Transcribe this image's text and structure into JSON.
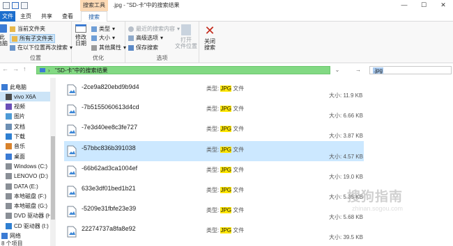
{
  "window": {
    "search_tools_label": "搜索工具",
    "title": ".jpg - \"SD-卡\"中的搜索结果",
    "minimize": "—",
    "maximize": "☐",
    "close": "✕"
  },
  "tabs": [
    "文件",
    "主页",
    "共享",
    "查看",
    "搜索"
  ],
  "ribbon": {
    "location": {
      "label": "位置",
      "this_pc": "此\n电脑",
      "current_folder": "当前文件夹",
      "all_subfolders": "所有子文件夹",
      "search_again": "在以下位置再次搜索"
    },
    "refine": {
      "label": "优化",
      "modified_date": "修改\n日期",
      "type": "类型",
      "size": "大小",
      "other_props": "其他属性"
    },
    "options": {
      "label": "选项",
      "recent": "最近的搜索内容",
      "advanced": "高级选项",
      "save_search": "保存搜索",
      "open_location": "打开\n文件位置"
    },
    "close": {
      "label": "关闭\n搜索"
    }
  },
  "address": {
    "path": "\"SD-卡\"中的搜索结果",
    "search_value": ".jpg"
  },
  "nav": [
    {
      "label": "此电脑",
      "icon": "computer-icon",
      "indent": 0
    },
    {
      "label": "vivo X6A",
      "icon": "phone-icon",
      "indent": 1,
      "selected": true
    },
    {
      "label": "视频",
      "icon": "video-folder-icon",
      "indent": 1
    },
    {
      "label": "图片",
      "icon": "pictures-folder-icon",
      "indent": 1
    },
    {
      "label": "文档",
      "icon": "documents-folder-icon",
      "indent": 1
    },
    {
      "label": "下载",
      "icon": "downloads-folder-icon",
      "indent": 1
    },
    {
      "label": "音乐",
      "icon": "music-folder-icon",
      "indent": 1
    },
    {
      "label": "桌面",
      "icon": "desktop-folder-icon",
      "indent": 1
    },
    {
      "label": "Windows (C:)",
      "icon": "drive-icon",
      "indent": 1
    },
    {
      "label": "LENOVO (D:)",
      "icon": "drive-icon",
      "indent": 1
    },
    {
      "label": "DATA (E:)",
      "icon": "drive-icon",
      "indent": 1
    },
    {
      "label": "本地磁盘 (F:)",
      "icon": "drive-icon",
      "indent": 1
    },
    {
      "label": "本地磁盘 (G:)",
      "icon": "drive-icon",
      "indent": 1
    },
    {
      "label": "DVD 驱动器 (H:)",
      "icon": "dvd-icon",
      "indent": 1
    },
    {
      "label": "CD 驱动器 (I:) vi",
      "icon": "cd-icon",
      "indent": 1
    },
    {
      "label": "网络",
      "icon": "network-icon",
      "indent": 0
    }
  ],
  "status": "8 个项目",
  "files": [
    {
      "name": "-2ce9a820ebd9b9d4",
      "type_prefix": "类型: ",
      "type_hl": "JPG",
      "type_suffix": " 文件",
      "size": "大小: 11.9 KB"
    },
    {
      "name": "-7b5155060613d4cd",
      "type_prefix": "类型: ",
      "type_hl": "JPG",
      "type_suffix": " 文件",
      "size": "大小: 6.66 KB"
    },
    {
      "name": "-7e3d40ee8c3fe727",
      "type_prefix": "类型: ",
      "type_hl": "JPG",
      "type_suffix": " 文件",
      "size": "大小: 3.87 KB"
    },
    {
      "name": "-57bbc836b391038",
      "type_prefix": "类型: ",
      "type_hl": "JPG",
      "type_suffix": " 文件",
      "size": "大小: 4.57 KB",
      "selected": true
    },
    {
      "name": "-66b62ad3ca1004ef",
      "type_prefix": "类型: ",
      "type_hl": "JPG",
      "type_suffix": " 文件",
      "size": "大小: 19.0 KB"
    },
    {
      "name": "633e3df01bed1b21",
      "type_prefix": "类型: ",
      "type_hl": "JPG",
      "type_suffix": " 文件",
      "size": "大小: 5.35 KB"
    },
    {
      "name": "-5209e31fbfe23e39",
      "type_prefix": "类型: ",
      "type_hl": "JPG",
      "type_suffix": " 文件",
      "size": "大小: 5.68 KB"
    },
    {
      "name": "22274737a8fa8e92",
      "type_prefix": "类型: ",
      "type_hl": "JPG",
      "type_suffix": " 文件",
      "size": "大小: 39.5 KB"
    }
  ],
  "watermark": {
    "text": "搜狗指南",
    "sub": "zhinan.sogou.com"
  }
}
